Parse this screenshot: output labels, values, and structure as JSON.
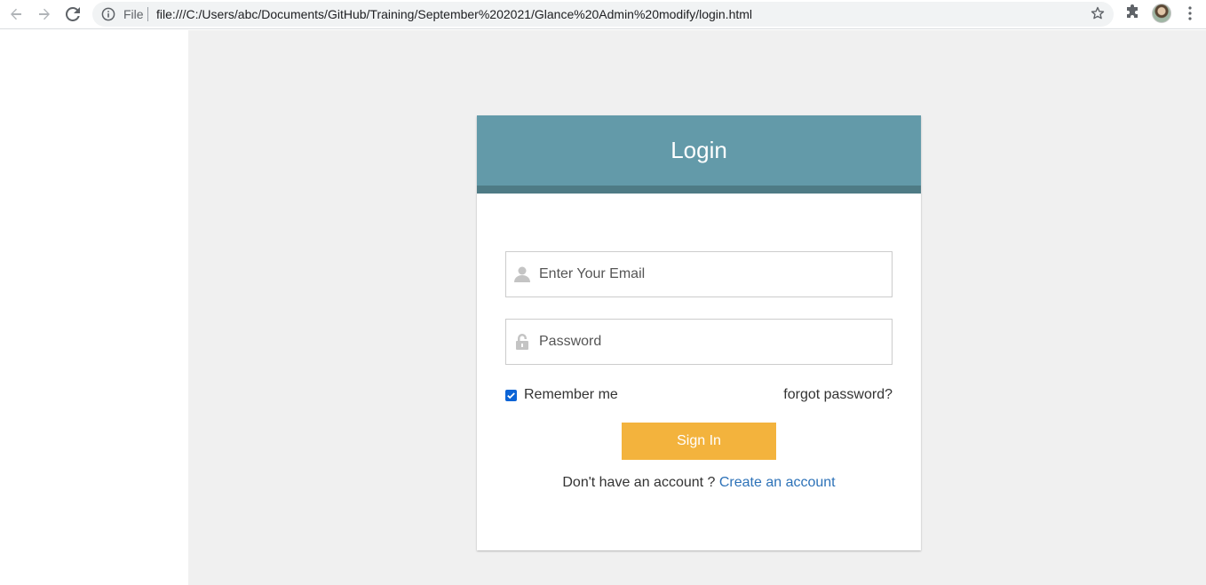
{
  "browser": {
    "scheme_label": "File",
    "url": "file:///C:/Users/abc/Documents/GitHub/Training/September%202021/Glance%20Admin%20modify/login.html",
    "icons": [
      "back-arrow-icon",
      "forward-arrow-icon",
      "reload-icon",
      "info-icon",
      "star-icon",
      "extensions-icon",
      "profile-avatar",
      "more-menu-icon"
    ]
  },
  "login": {
    "title": "Login",
    "email_placeholder": "Enter Your Email",
    "password_placeholder": "Password",
    "remember_label": "Remember me",
    "remember_checked": true,
    "forgot_label": "forgot password?",
    "signin_label": "Sign In",
    "signup_prompt": "Don't have an account ?",
    "signup_link": "Create an account"
  },
  "colors": {
    "header": "#639aa9",
    "header_bar": "#4e7b85",
    "button": "#f3b33d",
    "link": "#2d72b8",
    "page_bg": "#f0f0f0"
  }
}
